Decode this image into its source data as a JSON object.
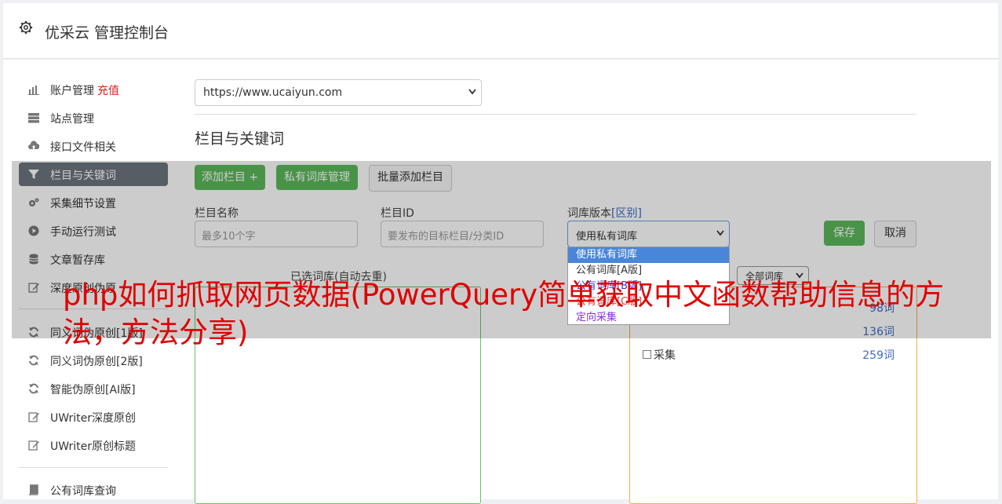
{
  "header": {
    "title": "优采云 管理控制台"
  },
  "sidebar": {
    "items": [
      {
        "label": "账户管理",
        "extra": "充值"
      },
      {
        "label": "站点管理"
      },
      {
        "label": "接口文件相关"
      },
      {
        "label": "栏目与关键词"
      },
      {
        "label": "采集细节设置"
      },
      {
        "label": "手动运行测试"
      },
      {
        "label": "文章暂存库"
      },
      {
        "label": "深度原创伪原"
      },
      {
        "label": "同义词伪原创[1版]"
      },
      {
        "label": "同义词伪原创[2版]"
      },
      {
        "label": "智能伪原创[AI版]"
      },
      {
        "label": "UWriter深度原创"
      },
      {
        "label": "UWriter原创标题"
      },
      {
        "label": "公有词库查询"
      }
    ]
  },
  "main": {
    "site_select": "https://www.ucaiyun.com",
    "section_title": "栏目与关键词",
    "buttons": {
      "add_column": "添加栏目 +",
      "private_lib": "私有词库管理",
      "batch_add": "批量添加栏目",
      "save": "保存",
      "cancel": "取消"
    },
    "form": {
      "column_name_label": "栏目名称",
      "column_name_placeholder": "最多10个字",
      "column_id_label": "栏目ID",
      "column_id_placeholder": "要发布的目标栏目/分类ID",
      "lib_version_label": "词库版本",
      "lib_version_link": "[区别]",
      "lib_version_value": "使用私有词库"
    },
    "dropdown_options": [
      "使用私有词库",
      "公有词库[A版]",
      "公有词库[B版]",
      "公有词库[C版]",
      "定向采集"
    ],
    "selected_words_label": "已选词库(自动去重)",
    "all_libs_select": "全部词库",
    "lib_list": [
      {
        "name": "",
        "count": "98词"
      },
      {
        "name": "",
        "count": "136词"
      },
      {
        "name": "采集",
        "count": "259词"
      }
    ]
  },
  "watermark": "php如何抓取网页数据(PowerQuery简单获取中文函数帮助信息的方法，方法分享)",
  "colors": {
    "green": "#5cb85c",
    "active_sidebar": "#6c757d",
    "recharge": "#e02020",
    "watermark": "#e00000"
  }
}
